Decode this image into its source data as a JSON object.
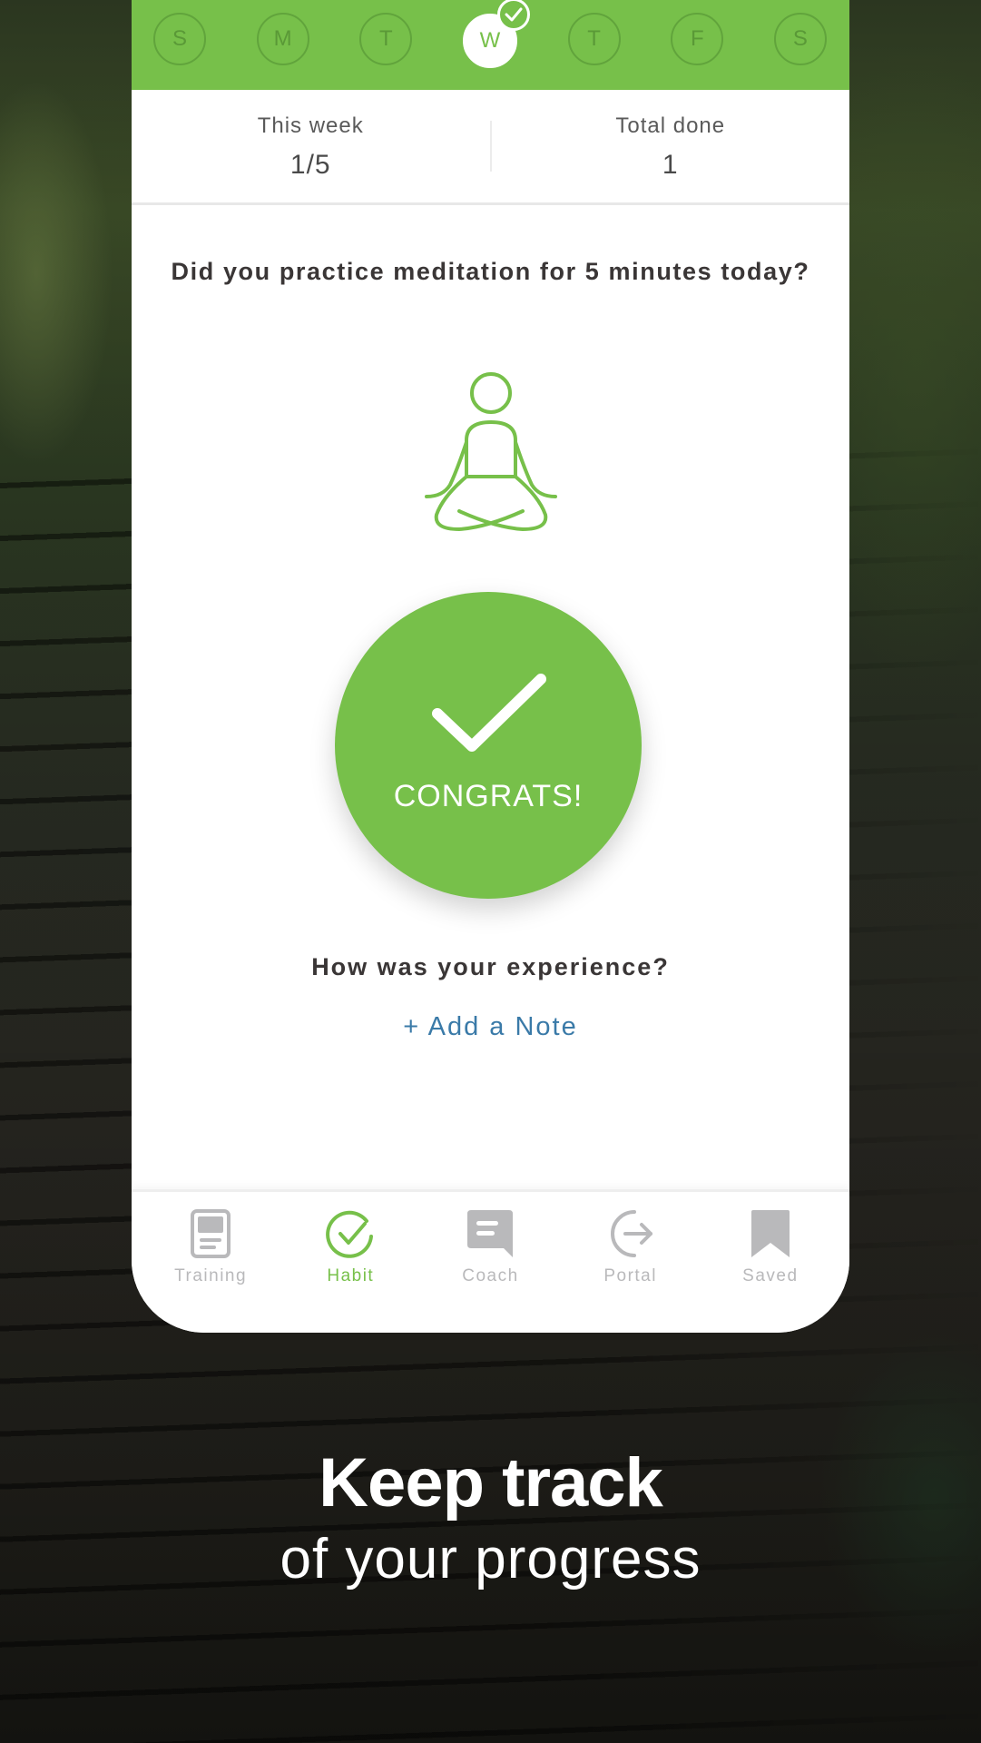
{
  "theme": {
    "accent": "#77c04a",
    "link": "#3a7aa8",
    "inactive": "#b9b9bb",
    "text": "#3a3636"
  },
  "week": {
    "days": [
      {
        "letter": "S",
        "done": false
      },
      {
        "letter": "M",
        "done": false
      },
      {
        "letter": "T",
        "done": false
      },
      {
        "letter": "W",
        "done": true,
        "today": true
      },
      {
        "letter": "T",
        "done": false
      },
      {
        "letter": "F",
        "done": false
      },
      {
        "letter": "S",
        "done": false
      }
    ]
  },
  "stats": {
    "this_week_label": "This week",
    "this_week_value": "1/5",
    "total_done_label": "Total done",
    "total_done_value": "1"
  },
  "habit": {
    "question": "Did you practice meditation for 5 minutes today?",
    "icon": "meditation-icon",
    "congrats_label": "CONGRATS!"
  },
  "note": {
    "prompt": "How was your experience?",
    "add_label": "+ Add a Note"
  },
  "tabbar": {
    "items": [
      {
        "label": "Training",
        "icon": "training-icon",
        "active": false
      },
      {
        "label": "Habit",
        "icon": "habit-check-icon",
        "active": true
      },
      {
        "label": "Coach",
        "icon": "chat-icon",
        "active": false
      },
      {
        "label": "Portal",
        "icon": "portal-exit-icon",
        "active": false
      },
      {
        "label": "Saved",
        "icon": "bookmark-icon",
        "active": false
      }
    ]
  },
  "tagline": {
    "title": "Keep track",
    "subtitle": "of your progress"
  }
}
